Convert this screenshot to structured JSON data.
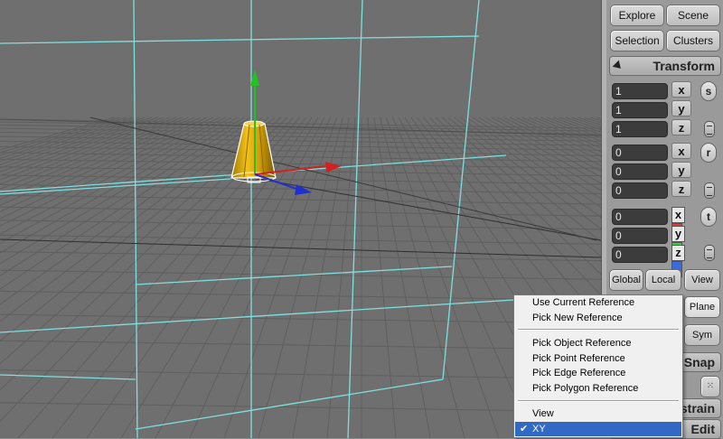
{
  "panel": {
    "explore": "Explore",
    "scene": "Scene",
    "selection": "Selection",
    "clusters": "Clusters",
    "transform_header": "Transform",
    "scale": {
      "x": "1",
      "y": "1",
      "z": "1",
      "mode": "s"
    },
    "rotate": {
      "x": "0",
      "y": "0",
      "z": "0",
      "mode": "r"
    },
    "translate": {
      "x": "0",
      "y": "0",
      "z": "0",
      "mode": "t"
    },
    "axis_labels": {
      "x": "x",
      "y": "y",
      "z": "z"
    },
    "global": "Global",
    "local": "Local",
    "view": "View",
    "plane": "Plane",
    "sym": "Sym",
    "snap": "Snap",
    "constrain_partial": "strain",
    "edit": "Edit"
  },
  "colors": {
    "axis_x": "#e03a3a",
    "axis_y": "#3ad03a",
    "axis_z": "#3a6ae0",
    "menu_highlight": "#316ac5"
  },
  "menu": {
    "items": [
      {
        "label": "Use Current Reference",
        "group": 1
      },
      {
        "label": "Pick New Reference",
        "group": 1
      },
      {
        "label": "Pick Object Reference",
        "group": 2
      },
      {
        "label": "Pick Point Reference",
        "group": 2
      },
      {
        "label": "Pick Edge Reference",
        "group": 2
      },
      {
        "label": "Pick Polygon Reference",
        "group": 2
      },
      {
        "label": "View",
        "group": 3
      },
      {
        "label": "XY",
        "group": 3,
        "checked": true,
        "selected": true
      }
    ],
    "check_mark": "✔"
  }
}
